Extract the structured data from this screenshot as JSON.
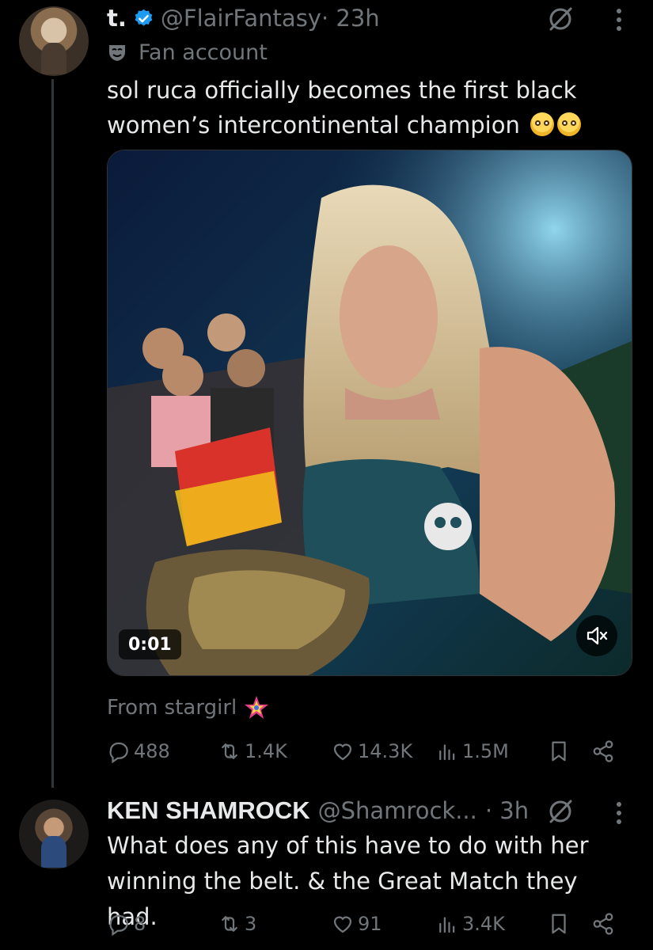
{
  "tweet": {
    "display_name": "t.",
    "handle": "@FlairFantasy",
    "time": "· 23h",
    "label": "Fan account",
    "text": "sol ruca officially becomes the first black women’s intercontinental champion",
    "video": {
      "timestamp": "0:01"
    },
    "from_text": "From stargirl",
    "stats": {
      "replies": "488",
      "reposts": "1.4K",
      "likes": "14.3K",
      "views": "1.5M"
    }
  },
  "reply": {
    "display_name": "KEN SHAMROCK",
    "handle": "@Shamrock...",
    "time": "· 3h",
    "text": "What does any of this have to do with her winning the belt. & the Great Match they had.",
    "stats": {
      "replies": "8",
      "reposts": "3",
      "likes": "91",
      "views": "3.4K"
    }
  },
  "colors": {
    "background": "#000000",
    "text": "#e7e9ea",
    "muted": "#71767b",
    "verified": "#1d9bf0",
    "divider": "#333639"
  },
  "icons": [
    "verified-badge-icon",
    "grok-icon",
    "more-icon",
    "fan-mask-icon",
    "mute-icon",
    "star-emoji-icon",
    "reply-icon",
    "repost-icon",
    "like-icon",
    "views-icon",
    "bookmark-icon",
    "share-icon"
  ]
}
